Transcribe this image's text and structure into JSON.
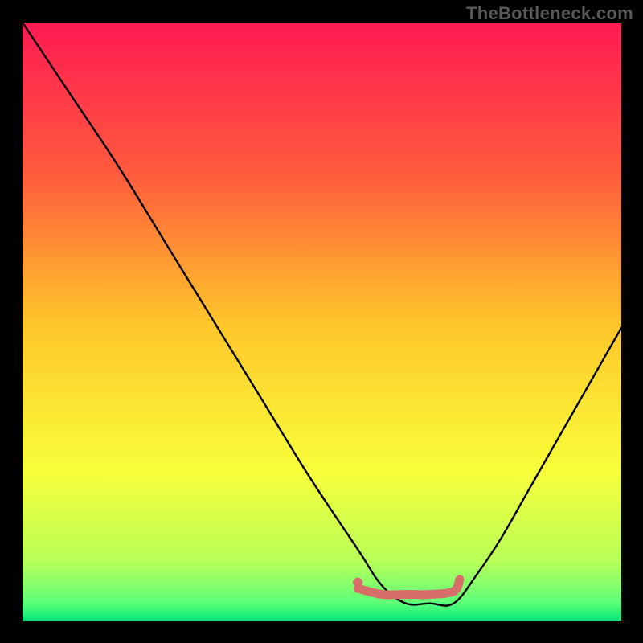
{
  "attribution": "TheBottleneck.com",
  "chart_data": {
    "type": "line",
    "title": "",
    "xlabel": "",
    "ylabel": "",
    "xlim": [
      0,
      100
    ],
    "ylim": [
      0,
      100
    ],
    "grid": false,
    "legend": false,
    "series": [
      {
        "name": "bottleneck-curve",
        "x": [
          0,
          8,
          16,
          24,
          32,
          40,
          48,
          56,
          60,
          64,
          68,
          72,
          76,
          80,
          84,
          88,
          92,
          96,
          100
        ],
        "values": [
          100,
          88,
          76,
          63,
          50,
          37,
          24,
          12,
          6,
          3,
          3,
          3,
          8,
          14,
          21,
          28,
          35,
          42,
          49
        ],
        "color": "#000000"
      },
      {
        "name": "optimal-range",
        "x": [
          56,
          60,
          64,
          68,
          72,
          73
        ],
        "values": [
          5.5,
          4.5,
          4.5,
          4.5,
          5.0,
          7.0
        ],
        "color": "#d86e6a"
      }
    ],
    "markers": [
      {
        "name": "optimal-start-dot",
        "x": 56,
        "y": 6.5,
        "color": "#d86e6a"
      }
    ],
    "background_gradient": [
      {
        "offset": 0.0,
        "color": "#ff1a53"
      },
      {
        "offset": 0.25,
        "color": "#ff5a3d"
      },
      {
        "offset": 0.5,
        "color": "#ffc52a"
      },
      {
        "offset": 0.75,
        "color": "#f8ff3a"
      },
      {
        "offset": 0.9,
        "color": "#b8ff58"
      },
      {
        "offset": 0.97,
        "color": "#5cff7a"
      },
      {
        "offset": 1.0,
        "color": "#00e67a"
      }
    ]
  }
}
